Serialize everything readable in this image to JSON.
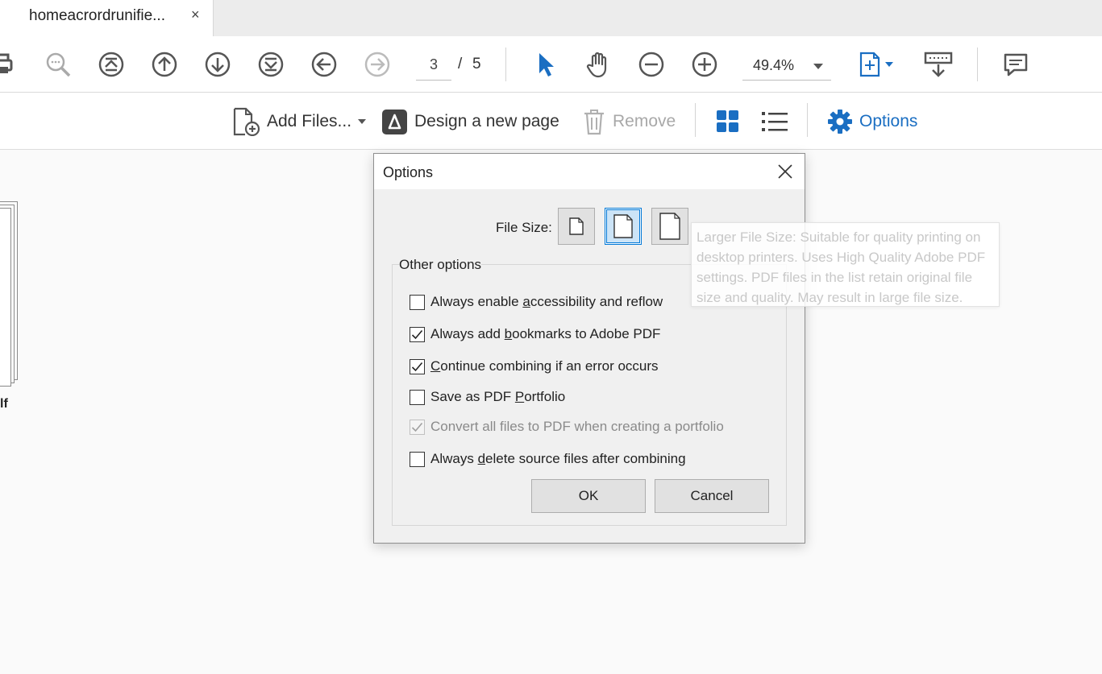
{
  "tab": {
    "title": "homeacrordrunifie...",
    "close": "×"
  },
  "toolbar": {
    "page_current": "3",
    "page_separator": "/",
    "page_total": "5",
    "zoom": "49.4%"
  },
  "subbar": {
    "add_files": "Add Files...",
    "design_page": "Design a new page",
    "remove": "Remove",
    "options": "Options"
  },
  "thumbnail": {
    "label": "lf"
  },
  "dialog": {
    "title": "Options",
    "file_size_label": "File Size:",
    "group_title": "Other options",
    "checkboxes": [
      {
        "pre": "Always enable ",
        "key": "a",
        "post": "ccessibility and reflow",
        "checked": false,
        "disabled": false
      },
      {
        "pre": "Always add ",
        "key": "b",
        "post": "ookmarks to Adobe PDF",
        "checked": true,
        "disabled": false
      },
      {
        "pre": "",
        "key": "C",
        "post": "ontinue combining if an error occurs",
        "checked": true,
        "disabled": false
      },
      {
        "pre": "Save as PDF ",
        "key": "P",
        "post": "ortfolio",
        "checked": false,
        "disabled": false
      },
      {
        "pre": "Convert all files to PDF when creating a portfolio",
        "key": "",
        "post": "",
        "checked": true,
        "disabled": true
      },
      {
        "pre": "Always ",
        "key": "d",
        "post": "elete source files after combining",
        "checked": false,
        "disabled": false
      }
    ],
    "ok": "OK",
    "cancel": "Cancel"
  },
  "tooltip": {
    "text": "Larger File Size: Suitable for quality printing on desktop printers. Uses High Quality Adobe PDF settings. PDF files in the list retain original file size and quality. May result in large file size."
  },
  "colors": {
    "accent": "#1a6ec2",
    "selected_border": "#0078d7",
    "dialog_bg": "#f0f0f0"
  }
}
